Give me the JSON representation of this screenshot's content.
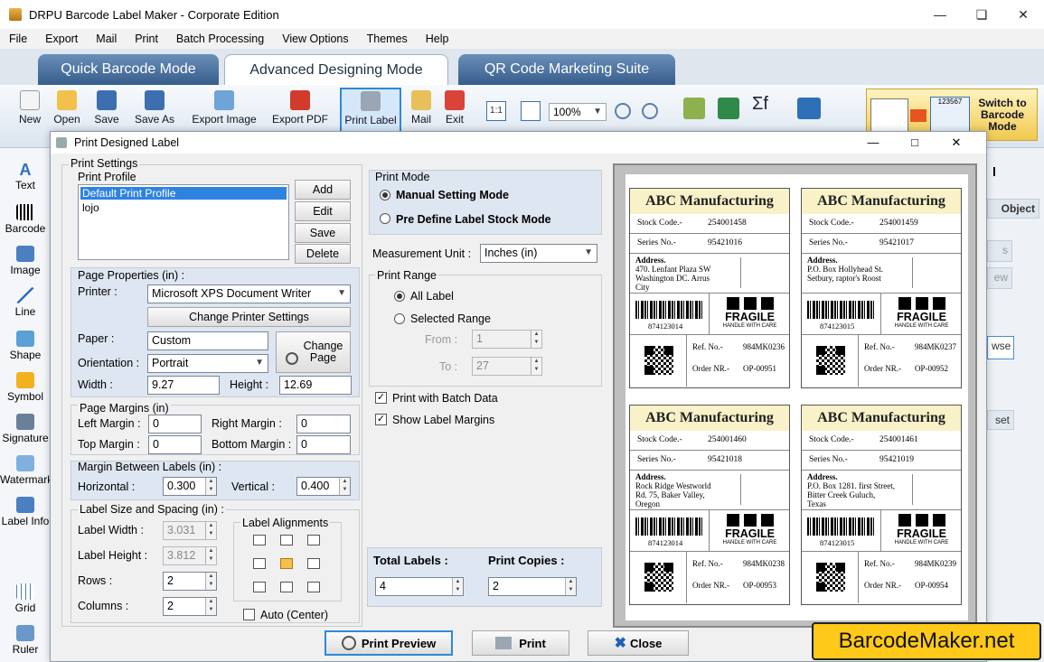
{
  "app": {
    "title": "DRPU Barcode Label Maker - Corporate Edition"
  },
  "menu": [
    "File",
    "Export",
    "Mail",
    "Print",
    "Batch Processing",
    "View Options",
    "Themes",
    "Help"
  ],
  "tabs": [
    "Quick Barcode Mode",
    "Advanced Designing Mode",
    "QR Code Marketing Suite"
  ],
  "toolbar": {
    "buttons": [
      "New",
      "Open",
      "Save",
      "Save As",
      "Export Image",
      "Export PDF",
      "Print Label",
      "Mail",
      "Exit"
    ],
    "zoom": "100%",
    "fit_label": "1:1",
    "switch_label": "Switch to Barcode Mode",
    "switch_sample": "123567"
  },
  "left_panel": [
    "Text",
    "Barcode",
    "Image",
    "Line",
    "Shape",
    "Symbol",
    "Signature",
    "Watermark",
    "Label Info",
    "Grid",
    "Ruler"
  ],
  "right_panel": {
    "object_label": "Object",
    "frag1": "l",
    "frag2": "s",
    "frag3": "ew",
    "frag4": "wse",
    "frag5": "set"
  },
  "dialog": {
    "title": "Print Designed Label",
    "print_settings": "Print Settings",
    "print_profile": {
      "label": "Print Profile",
      "items": [
        "Default Print Profile",
        "lojo"
      ],
      "buttons": [
        "Add",
        "Edit",
        "Save",
        "Delete"
      ]
    },
    "page_properties": {
      "label": "Page Properties (in) :",
      "printer_label": "Printer :",
      "printer_value": "Microsoft XPS Document Writer",
      "change_printer": "Change Printer Settings",
      "paper_label": "Paper :",
      "paper_value": "Custom",
      "change_page": "Change Page",
      "orientation_label": "Orientation :",
      "orientation_value": "Portrait",
      "width_label": "Width :",
      "width_value": "9.27",
      "height_label": "Height :",
      "height_value": "12.69"
    },
    "page_margins": {
      "label": "Page Margins (in)",
      "left_label": "Left Margin :",
      "left": "0",
      "right_label": "Right Margin :",
      "right": "0",
      "top_label": "Top Margin :",
      "top": "0",
      "bottom_label": "Bottom Margin :",
      "bottom": "0"
    },
    "margin_between": {
      "label": "Margin Between Labels (in) :",
      "horizontal_label": "Horizontal :",
      "horizontal": "0.300",
      "vertical_label": "Vertical :",
      "vertical": "0.400"
    },
    "label_size": {
      "label": "Label Size and Spacing (in) :",
      "width_label": "Label Width :",
      "width": "3.031",
      "height_label": "Label Height :",
      "height": "3.812",
      "rows_label": "Rows :",
      "rows": "2",
      "columns_label": "Columns :",
      "columns": "2",
      "alignments_label": "Label Alignments",
      "auto_center": "Auto (Center)"
    },
    "print_mode": {
      "label": "Print Mode",
      "manual": "Manual Setting Mode",
      "predefine": "Pre Define Label Stock Mode"
    },
    "measurement": {
      "label": "Measurement Unit :",
      "value": "Inches (in)"
    },
    "print_range": {
      "label": "Print Range",
      "all": "All Label",
      "selected": "Selected Range",
      "from_label": "From :",
      "from": "1",
      "to_label": "To :",
      "to": "27"
    },
    "batch": "Print with Batch Data",
    "show_margins": "Show Label Margins",
    "totals": {
      "total_label": "Total Labels :",
      "total": "4",
      "copies_label": "Print Copies :",
      "copies": "2"
    },
    "buttons": {
      "preview": "Print Preview",
      "print": "Print",
      "close": "Close"
    }
  },
  "labels": [
    {
      "company": "ABC Manufacturing",
      "stock_label": "Stock Code.-",
      "stock": "254001458",
      "series_label": "Series No.-",
      "series": "95421016",
      "addr_label": "Address.",
      "addr1": "470. Lenfant Plaza SW",
      "addr2": "Washington DC. Arrus",
      "addr3": "City",
      "barcode": "874123014",
      "fragile": "FRAGILE",
      "fragile_sub": "HANDLE WITH CARE",
      "ref_label": "Ref. No.-",
      "ref": "984MK0236",
      "order_label": "Order NR.-",
      "order": "OP-00951"
    },
    {
      "company": "ABC Manufacturing",
      "stock_label": "Stock Code.-",
      "stock": "254001459",
      "series_label": "Series No.-",
      "series": "95421017",
      "addr_label": "Address.",
      "addr1": "P.O. Box Hollyhead St.",
      "addr2": "Setbury, raptor's Roost",
      "addr3": "",
      "barcode": "874123015",
      "fragile": "FRAGILE",
      "fragile_sub": "HANDLE WITH CARE",
      "ref_label": "Ref. No.-",
      "ref": "984MK0237",
      "order_label": "Order NR.-",
      "order": "OP-00952"
    },
    {
      "company": "ABC Manufacturing",
      "stock_label": "Stock Code.-",
      "stock": "254001460",
      "series_label": "Series No.-",
      "series": "95421018",
      "addr_label": "Address.",
      "addr1": "Rock Ridge Westworld",
      "addr2": "Rd. 75, Baker Valley,",
      "addr3": "Oregon",
      "barcode": "874123014",
      "fragile": "FRAGILE",
      "fragile_sub": "HANDLE WITH CARE",
      "ref_label": "Ref. No.-",
      "ref": "984MK0238",
      "order_label": "Order NR.-",
      "order": "OP-00953"
    },
    {
      "company": "ABC Manufacturing",
      "stock_label": "Stock Code.-",
      "stock": "254001461",
      "series_label": "Series No.-",
      "series": "95421019",
      "addr_label": "Address.",
      "addr1": "P.O. Box 1281. first Street,",
      "addr2": "Bitter Creek Guluch,",
      "addr3": "Texas",
      "barcode": "874123015",
      "fragile": "FRAGILE",
      "fragile_sub": "HANDLE WITH CARE",
      "ref_label": "Ref. No.-",
      "ref": "984MK0239",
      "order_label": "Order NR.-",
      "order": "OP-00954"
    }
  ],
  "branding": "BarcodeMaker.net",
  "colors": {
    "accent": "#2e89d6",
    "tab_inactive": "#4a72a3",
    "label_header": "#f9f1c8",
    "brand_yellow": "#ffc91a"
  }
}
